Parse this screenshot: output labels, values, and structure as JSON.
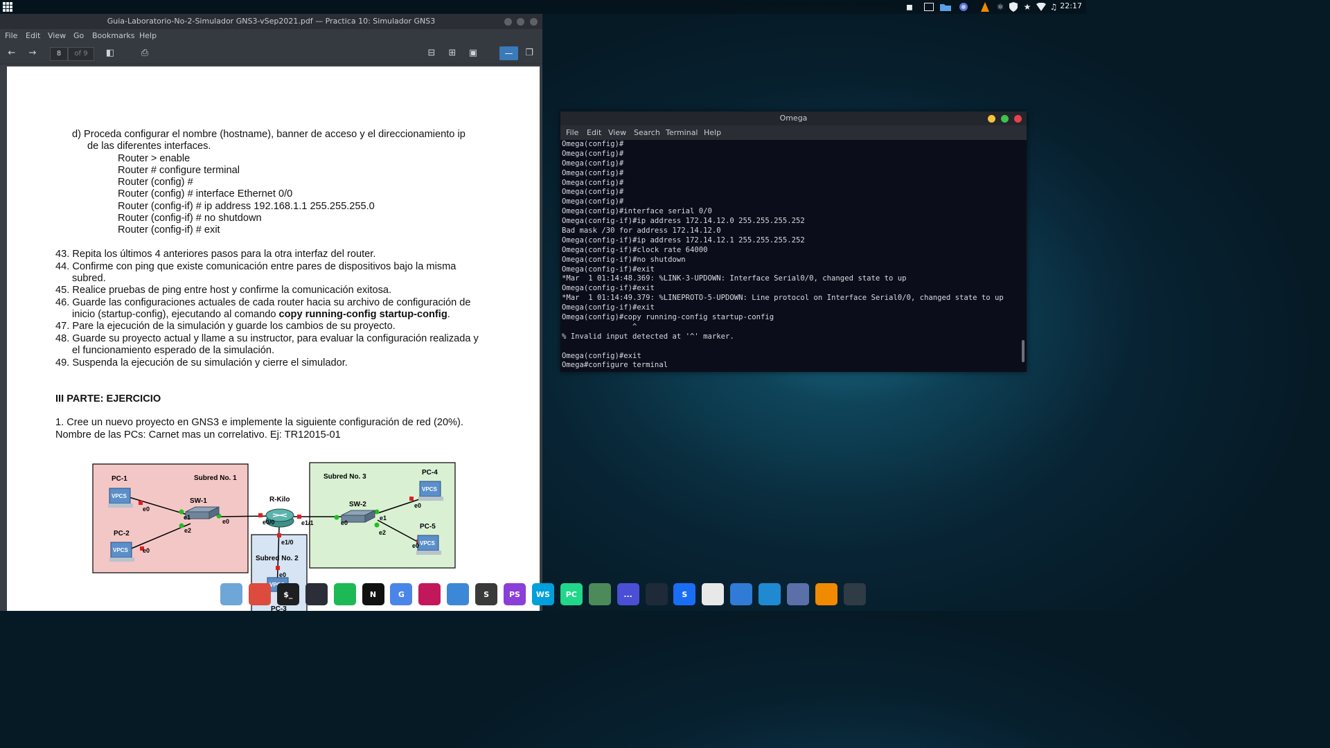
{
  "top_panel": {
    "clock": "22:17",
    "tray_icons": [
      "trash-icon",
      "terminal-icon",
      "folder-icon",
      "firefox-icon",
      "vlc-icon",
      "bluetooth-icon",
      "shield-icon",
      "star-icon",
      "wifi-icon",
      "music-icon"
    ]
  },
  "pdf_viewer": {
    "title": "Guia-Laboratorio-No-2-Simulador GNS3-vSep2021.pdf — Practica 10: Simulador GNS3",
    "menu": [
      "File",
      "Edit",
      "View",
      "Go",
      "Bookmarks",
      "Help"
    ],
    "page_current": "8",
    "page_total": "of 9",
    "content": {
      "step_d_line1": "d)   Proceda configurar el nombre (hostname), banner de acceso y el direccionamiento ip",
      "step_d_line2": "de las diferentes interfaces.",
      "cmds": [
        "Router > enable",
        "Router # configure terminal",
        "Router (config) #",
        "Router (config) # interface Ethernet 0/0",
        "Router (config-if) # ip address 192.168.1.1 255.255.255.0",
        "Router (config-if) # no shutdown",
        "Router (config-if) # exit"
      ],
      "item43": "43. Repita los últimos 4 anteriores pasos para la otra interfaz del router.",
      "item44_a": "44. Confirme  con  ping  que  existe  comunicación  entre  pares  de  dispositivos  bajo  la  misma",
      "item44_b": "subred.",
      "item45": "45. Realice pruebas de ping entre host y confirme la comunicación exitosa.",
      "item46_a": "46. Guarde las configuraciones actuales de cada router hacia su archivo de configuración de",
      "item46_b_pre": "inicio (startup-config), ejecutando al comando ",
      "item46_b_bold": "copy running-config startup-config",
      "item46_b_post": ".",
      "item47": "47. Pare la ejecución de la simulación y guarde los cambios de su proyecto.",
      "item48_a": "48. Guarde su proyecto actual y llame a su instructor, para evaluar la configuración realizada y",
      "item48_b": "el funcionamiento esperado de la simulación.",
      "item49": "49. Suspenda la ejecución de su simulación y cierre el simulador.",
      "part3": "III PARTE: EJERCICIO",
      "ex1_a": "1. Cree un nuevo proyecto en GNS3 e implemente la siguiente configuración de red (20%).",
      "ex1_b": "Nombre de las PCs: Carnet mas un correlativo. Ej: TR12015-01"
    },
    "diagram": {
      "subnet1": "Subred No. 1",
      "subnet2": "Subred No. 2",
      "subnet3": "Subred No. 3",
      "pc1": "PC-1",
      "pc2": "PC-2",
      "pc3": "PC-3",
      "pc4": "PC-4",
      "pc5": "PC-5",
      "sw1": "SW-1",
      "sw2": "SW-2",
      "router": "R-Kilo",
      "vpcs": "VPCS",
      "e0": "e0",
      "e1": "e1",
      "e2": "e2",
      "e0_0": "e0/0",
      "e1_0": "e1/0",
      "e1_1": "e1/1"
    }
  },
  "terminal": {
    "title": "Omega",
    "menu": [
      "File",
      "Edit",
      "View",
      "Search",
      "Terminal",
      "Help"
    ],
    "lines": [
      "Omega(config)#",
      "Omega(config)#",
      "Omega(config)#",
      "Omega(config)#",
      "Omega(config)#",
      "Omega(config)#",
      "Omega(config)#",
      "Omega(config)#interface serial 0/0",
      "Omega(config-if)#ip address 172.14.12.0 255.255.255.252",
      "Bad mask /30 for address 172.14.12.0",
      "Omega(config-if)#ip address 172.14.12.1 255.255.255.252",
      "Omega(config-if)#clock rate 64000",
      "Omega(config-if)#no shutdown",
      "Omega(config-if)#exit",
      "*Mar  1 01:14:48.369: %LINK-3-UPDOWN: Interface Serial0/0, changed state to up",
      "Omega(config-if)#exit",
      "*Mar  1 01:14:49.379: %LINEPROTO-5-UPDOWN: Line protocol on Interface Serial0/0, changed state to up",
      "Omega(config-if)#exit",
      "Omega(config)#copy running-config startup-config",
      "                ^",
      "% Invalid input detected at '^' marker.",
      "",
      "Omega(config)#exit",
      "Omega#configure terminal"
    ]
  },
  "dock": {
    "items": [
      {
        "name": "files-icon",
        "label": "",
        "color": "#6ea6d8"
      },
      {
        "name": "chrome-icon",
        "label": "",
        "color": "#dd4b3e"
      },
      {
        "name": "terminal-app-icon",
        "label": "$_",
        "color": "#1d1f21"
      },
      {
        "name": "obs-icon",
        "label": "",
        "color": "#2b2e38"
      },
      {
        "name": "spotify-icon",
        "label": "",
        "color": "#1db954"
      },
      {
        "name": "netflix-icon",
        "label": "N",
        "color": "#111111"
      },
      {
        "name": "translate-icon",
        "label": "G",
        "color": "#4a86e8"
      },
      {
        "name": "docs-icon",
        "label": "",
        "color": "#c2185b"
      },
      {
        "name": "libreoffice-writer-icon",
        "label": "",
        "color": "#3d88d6"
      },
      {
        "name": "sublime-icon",
        "label": "S",
        "color": "#3a3a3a"
      },
      {
        "name": "phpstorm-icon",
        "label": "PS",
        "color": "#8b3fd9"
      },
      {
        "name": "webstorm-icon",
        "label": "WS",
        "color": "#00a0dc"
      },
      {
        "name": "pycharm-icon",
        "label": "PC",
        "color": "#21d789"
      },
      {
        "name": "system-monitor-icon",
        "label": "",
        "color": "#4c8a5a"
      },
      {
        "name": "workspace-icon",
        "label": "...",
        "color": "#4a4fd6"
      },
      {
        "name": "mixer-icon",
        "label": "",
        "color": "#1e2a38"
      },
      {
        "name": "shazam-icon",
        "label": "S",
        "color": "#1a6ef5"
      },
      {
        "name": "pdf-editor-icon",
        "label": "",
        "color": "#e8e8e8"
      },
      {
        "name": "trello-icon",
        "label": "",
        "color": "#2f7bd6"
      },
      {
        "name": "vscode-icon",
        "label": "",
        "color": "#1f8ad2"
      },
      {
        "name": "gns3-icon",
        "label": "",
        "color": "#5b6fa8"
      },
      {
        "name": "vlc-dock-icon",
        "label": "",
        "color": "#f08a00"
      },
      {
        "name": "google-play-icon",
        "label": "",
        "color": "#2f3b45"
      }
    ]
  }
}
